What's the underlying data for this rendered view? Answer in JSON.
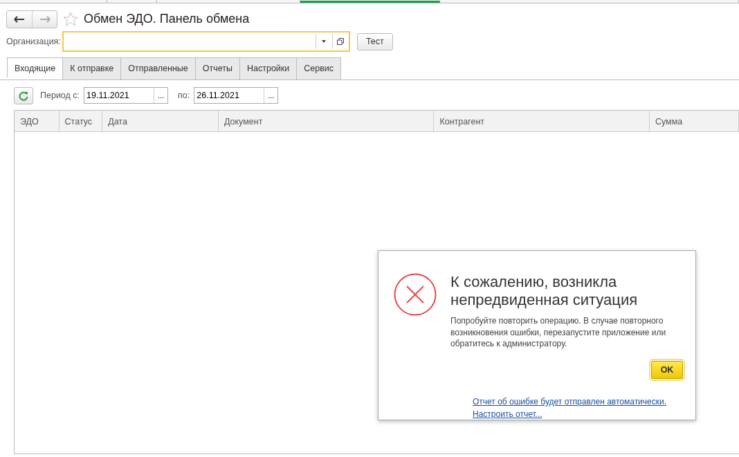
{
  "top_strip": {
    "windows": [
      {
        "selected": false
      },
      {
        "selected": false
      },
      {
        "selected": false
      },
      {
        "selected": true
      },
      {
        "selected": false
      }
    ]
  },
  "window": {
    "title": "Обмен ЭДО. Панель обмена",
    "favorite": false
  },
  "organization": {
    "label": "Организация:"
  },
  "test_button": "Тест",
  "tabs": [
    {
      "label": "Входящие",
      "selected": true
    },
    {
      "label": "К отправке",
      "selected": false
    },
    {
      "label": "Отправленные",
      "selected": false
    },
    {
      "label": "Отчеты",
      "selected": false
    },
    {
      "label": "Настройки",
      "selected": false
    },
    {
      "label": "Сервис",
      "selected": false
    }
  ],
  "period": {
    "from_label": "Период с:",
    "from": "19.11.2021",
    "to_label": "по:",
    "to": "26.11.2021",
    "picker": "..."
  },
  "table": {
    "columns": [
      "ЭДО",
      "Статус",
      "Дата",
      "Документ",
      "Контрагент",
      "Сумма"
    ]
  },
  "dialog": {
    "title": "К сожалению, возникла непредвиденная ситуация",
    "message": "Попробуйте повторить операцию. В случае повторного возникновения ошибки, перезапустите приложение или обратитесь к администратору.",
    "ok_button": "OK",
    "links": [
      "Отчет об ошибке будет отправлен автоматически.",
      "Настроить отчет..."
    ]
  }
}
